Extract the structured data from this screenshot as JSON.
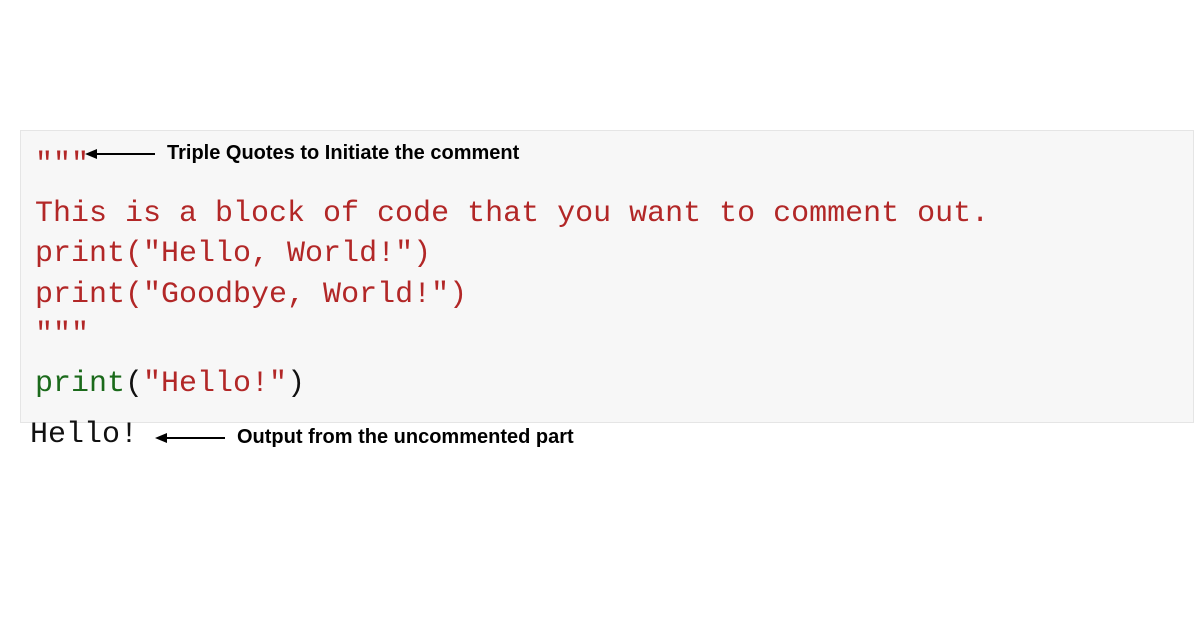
{
  "annotations": {
    "triple_quote_label": "Triple Quotes to Initiate the comment",
    "output_label": "Output from the uncommented part"
  },
  "code": {
    "open_quotes": "\"\"\"",
    "line1": "This is a block of code that you want to comment out.",
    "line2_func": "print",
    "line2_open": "(",
    "line2_str": "\"Hello, World!\"",
    "line2_close": ")",
    "line3_func": "print",
    "line3_open": "(",
    "line3_str": "\"Goodbye, World!\"",
    "line3_close": ")",
    "close_quotes": "\"\"\"",
    "line5_func": "print",
    "line5_open": "(",
    "line5_str": "\"Hello!\"",
    "line5_close": ")"
  },
  "output": {
    "text": "Hello!"
  }
}
